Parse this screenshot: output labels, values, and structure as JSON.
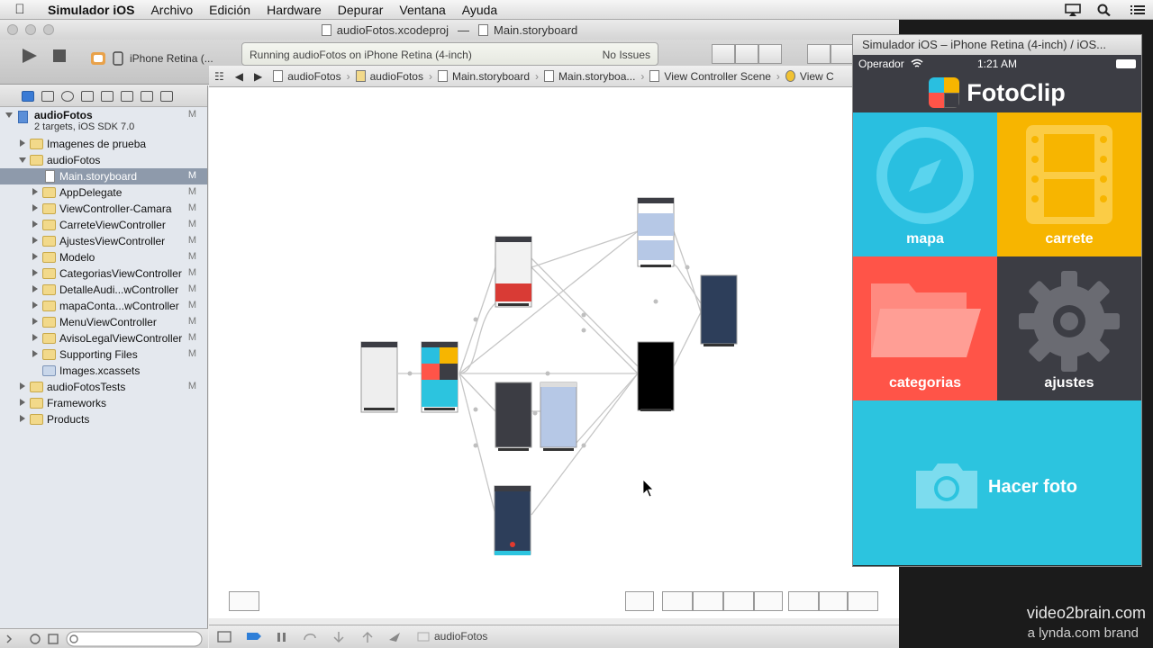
{
  "menubar": {
    "app": "Simulador iOS",
    "items": [
      "Archivo",
      "Edición",
      "Hardware",
      "Depurar",
      "Ventana",
      "Ayuda"
    ]
  },
  "xcode": {
    "title_project": "audioFotos.xcodeproj",
    "title_sep": "—",
    "title_file": "Main.storyboard",
    "scheme_device": "iPhone Retina (...",
    "status_left": "Running audioFotos on iPhone Retina (4-inch)",
    "status_right": "No Issues",
    "tree": [
      {
        "label": "audioFotos",
        "sub": "2 targets, iOS SDK 7.0",
        "badge": "M"
      },
      {
        "label": "Imagenes de prueba",
        "badge": ""
      },
      {
        "label": "audioFotos",
        "badge": ""
      },
      {
        "label": "Main.storyboard",
        "badge": "M"
      },
      {
        "label": "AppDelegate",
        "badge": "M"
      },
      {
        "label": "ViewController-Camara",
        "badge": "M"
      },
      {
        "label": "CarreteViewController",
        "badge": "M"
      },
      {
        "label": "AjustesViewController",
        "badge": "M"
      },
      {
        "label": "Modelo",
        "badge": "M"
      },
      {
        "label": "CategoriasViewController",
        "badge": "M"
      },
      {
        "label": "DetalleAudi...wController",
        "badge": "M"
      },
      {
        "label": "mapaConta...wController",
        "badge": "M"
      },
      {
        "label": "MenuViewController",
        "badge": "M"
      },
      {
        "label": "AvisoLegalViewController",
        "badge": "M"
      },
      {
        "label": "Supporting Files",
        "badge": "M"
      },
      {
        "label": "Images.xcassets",
        "badge": ""
      },
      {
        "label": "audioFotosTests",
        "badge": "M"
      },
      {
        "label": "Frameworks",
        "badge": ""
      },
      {
        "label": "Products",
        "badge": ""
      }
    ],
    "breadcrumbs": [
      "audioFotos",
      "audioFotos",
      "Main.storyboard",
      "Main.storyboa...",
      "View Controller Scene",
      "View C"
    ],
    "debug_target": "audioFotos"
  },
  "simulator": {
    "title": "Simulador iOS – iPhone Retina (4-inch) / iOS...",
    "carrier": "Operador",
    "time": "1:21 AM",
    "app_name": "FotoClip",
    "tiles": {
      "mapa": "mapa",
      "carrete": "carrete",
      "categorias": "categorias",
      "ajustes": "ajustes",
      "hacer_foto": "Hacer foto"
    },
    "colors": {
      "mapa": "#29bfe0",
      "carrete": "#f7b500",
      "categorias": "#ff5448",
      "ajustes": "#3c3d44",
      "hacer_foto": "#2cc4df"
    }
  },
  "watermark": {
    "line1": "video2brain.com",
    "line2": "a lynda.com brand"
  }
}
